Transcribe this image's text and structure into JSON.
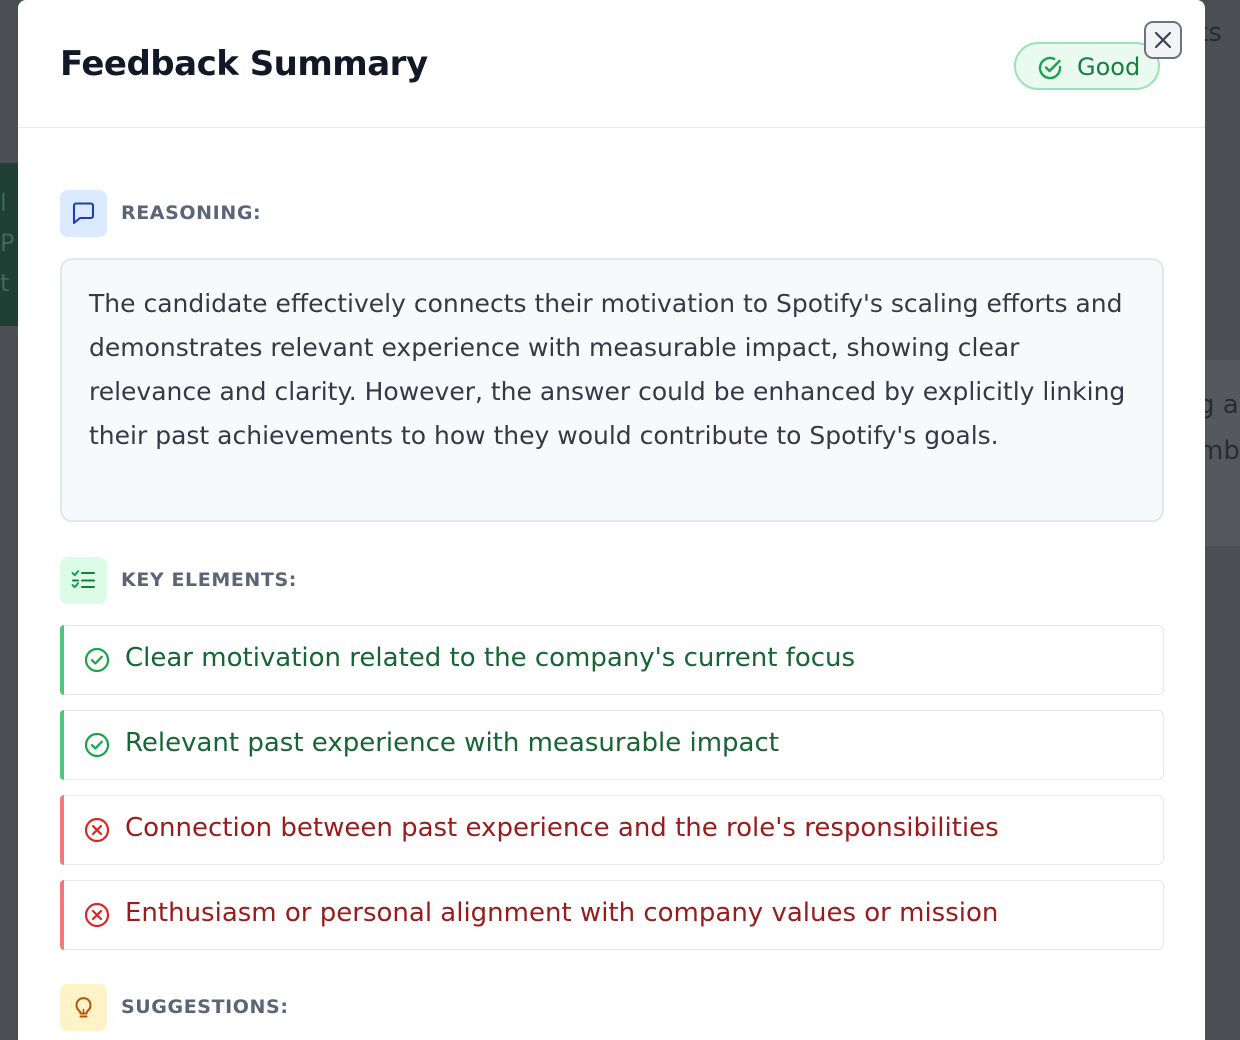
{
  "background": {
    "left_fragments": [
      "l",
      "P",
      "t"
    ],
    "right_fragments": [
      "ts",
      "g a",
      "mb"
    ]
  },
  "modal": {
    "title": "Feedback Summary",
    "rating": {
      "label": "Good",
      "icon": "check-circle-icon",
      "color": "#15803d"
    },
    "close": {
      "icon": "close-icon"
    }
  },
  "reasoning": {
    "label": "REASONING:",
    "icon": "message-square-icon",
    "text": "The candidate effectively connects their motivation to Spotify's scaling efforts and demonstrates relevant experience with measurable impact, showing clear relevance and clarity. However, the answer could be enhanced by explicitly linking their past achievements to how they would contribute to Spotify's goals."
  },
  "key_elements": {
    "label": "KEY ELEMENTS:",
    "icon": "list-checks-icon",
    "items": [
      {
        "text": "Clear motivation related to the company's current focus",
        "status": "met"
      },
      {
        "text": "Relevant past experience with measurable impact",
        "status": "met"
      },
      {
        "text": "Connection between past experience and the role's responsibilities",
        "status": "missing"
      },
      {
        "text": "Enthusiasm or personal alignment with company values or mission",
        "status": "missing"
      }
    ]
  },
  "suggestions": {
    "label": "SUGGESTIONS:",
    "icon": "lightbulb-icon"
  },
  "colors": {
    "good": "#15803d",
    "bad": "#991b1b",
    "good_accent": "#4cc97a",
    "bad_accent": "#f07a7a"
  }
}
